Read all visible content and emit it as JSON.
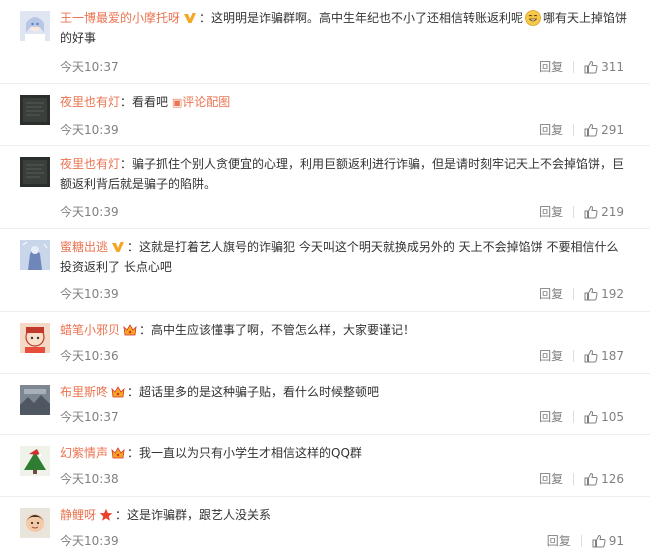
{
  "comments": [
    {
      "user": "王一博最爱的小摩托呀",
      "colon": "：",
      "text": "这明明是诈骗群啊。高中生年纪也不小了还相信转账返利呢",
      "text_after_emoji": "哪有天上掉馅饼的好事",
      "time": "今天10:37",
      "reply_label": "回复",
      "likes": "311",
      "badge": "v-badge-icon",
      "avatar_icon": "anime-girl-avatar"
    },
    {
      "user": "夜里也有灯",
      "colon": "：",
      "text": "看看吧",
      "link_text": "评论配图",
      "time": "今天10:39",
      "reply_label": "回复",
      "likes": "291",
      "avatar_icon": "dark-photo-avatar"
    },
    {
      "user": "夜里也有灯",
      "colon": "：",
      "text": "骗子抓住个别人贪便宜的心理，利用巨额返利进行诈骗，但是请时刻牢记天上不会掉馅饼，巨额返利背后就是骗子的陷阱。",
      "time": "今天10:39",
      "reply_label": "回复",
      "likes": "219",
      "avatar_icon": "dark-photo-avatar"
    },
    {
      "user": "蜜糖出逃",
      "colon": "：",
      "text": "这就是打着艺人旗号的诈骗犯 今天叫这个明天就换成另外的 天上不会掉馅饼 不要相信什么投资返利了 长点心吧",
      "time": "今天10:39",
      "reply_label": "回复",
      "likes": "192",
      "badge": "v-badge-icon",
      "avatar_icon": "blue-figure-avatar"
    },
    {
      "user": "蜡笔小邪贝",
      "colon": "：",
      "text": "高中生应该懂事了啊，不管怎么样，大家要谨记！",
      "time": "今天10:36",
      "reply_label": "回复",
      "likes": "187",
      "badge": "crown-badge-icon",
      "avatar_icon": "cartoon-avatar"
    },
    {
      "user": "布里斯咚",
      "colon": "：",
      "text": "超话里多的是这种骗子贴，看什么时候整顿吧",
      "time": "今天10:37",
      "reply_label": "回复",
      "likes": "105",
      "badge": "crown-badge-icon",
      "avatar_icon": "grey-scene-avatar"
    },
    {
      "user": "幻紫情声",
      "colon": "：",
      "text": "我一直以为只有小学生才相信这样的QQ群",
      "time": "今天10:38",
      "reply_label": "回复",
      "likes": "126",
      "badge": "crown-badge-icon",
      "avatar_icon": "christmas-avatar"
    },
    {
      "user": "静鲤呀",
      "colon": "：",
      "text": "这是诈骗群，跟艺人没关系",
      "time": "今天10:39",
      "reply_label": "回复",
      "likes": "91",
      "badge": "star-badge-icon",
      "avatar_icon": "child-photo-avatar"
    }
  ],
  "colors": {
    "username": "#eb7350",
    "text": "#333333",
    "meta": "#808080",
    "divider": "#eeeeee"
  }
}
